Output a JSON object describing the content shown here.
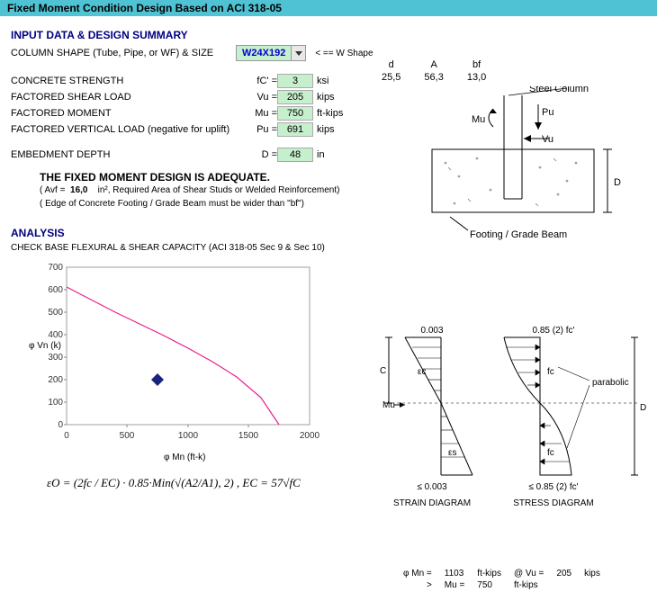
{
  "title_bar": "Fixed Moment Condition Design Based on ACI 318-05",
  "headers": {
    "input": "INPUT DATA & DESIGN SUMMARY",
    "analysis": "ANALYSIS"
  },
  "column_shape": {
    "label": "COLUMN SHAPE (Tube, Pipe, or WF) & SIZE",
    "value": "W24X192",
    "hint": "< ==    W Shape"
  },
  "shape_props": {
    "headers": [
      "d",
      "A",
      "bf"
    ],
    "values": [
      "25,5",
      "56,3",
      "13,0"
    ]
  },
  "inputs": {
    "fc": {
      "label": "CONCRETE STRENGTH",
      "sym": "fC' =",
      "value": "3",
      "unit": "ksi"
    },
    "vu": {
      "label": "FACTORED SHEAR LOAD",
      "sym": "Vu =",
      "value": "205",
      "unit": "kips"
    },
    "mu": {
      "label": "FACTORED MOMENT",
      "sym": "Mu =",
      "value": "750",
      "unit": "ft-kips"
    },
    "pu": {
      "label": "FACTORED VERTICAL LOAD (negative for uplift)",
      "sym": "Pu =",
      "value": "691",
      "unit": "kips"
    },
    "d": {
      "label": "EMBEDMENT DEPTH",
      "sym": "D =",
      "value": "48",
      "unit": "in"
    }
  },
  "adequate_msg": "THE FIXED MOMENT DESIGN IS ADEQUATE.",
  "avf": {
    "prefix": "( Avf  =",
    "value": "16,0",
    "unit": "in²",
    "note": ", Required Area of Shear Studs or Welded Reinforcement)"
  },
  "edge_note": "( Edge of Concrete Footing / Grade Beam must be wider than \"bf\")",
  "analysis_sub": "CHECK BASE FLEXURAL & SHEAR CAPACITY (ACI 318-05 Sec 9 & Sec 10)",
  "sketch": {
    "steel_col": "Steel Column",
    "mu": "Mu",
    "pu": "Pu",
    "vu": "Vu",
    "footing": "Footing  /  Grade Beam",
    "d": "D"
  },
  "chart_data": {
    "type": "line+scatter",
    "xlabel": "φ Mn (ft-k)",
    "ylabel": "φ Vn (k)",
    "xlim": [
      0,
      2000
    ],
    "ylim": [
      0,
      700
    ],
    "xticks": [
      0,
      500,
      1000,
      1500,
      2000
    ],
    "yticks": [
      0,
      100,
      200,
      300,
      400,
      500,
      600,
      700
    ],
    "series": [
      {
        "name": "capacity-curve",
        "color": "#e91e8c",
        "type": "line",
        "points": [
          [
            0,
            610
          ],
          [
            200,
            555
          ],
          [
            400,
            500
          ],
          [
            600,
            448
          ],
          [
            800,
            395
          ],
          [
            1000,
            340
          ],
          [
            1200,
            280
          ],
          [
            1400,
            210
          ],
          [
            1600,
            120
          ],
          [
            1750,
            0
          ]
        ]
      },
      {
        "name": "demand-point",
        "color": "#1a237e",
        "type": "scatter",
        "points": [
          [
            750,
            205
          ]
        ]
      }
    ]
  },
  "strain_stress": {
    "top1": "0.003",
    "top2": "0.85 (2) fc'",
    "ec": "εc",
    "fc": "fc",
    "mu": "Mu",
    "es": "εs",
    "bot1": "≤ 0.003",
    "bot2": "≤ 0.85 (2) fc'",
    "label1": "STRAIN  DIAGRAM",
    "label2": "STRESS  DIAGRAM",
    "parabolic": "parabolic",
    "c": "C",
    "d": "D"
  },
  "formula": "εO = (2fc / EC) · 0.85·Min(√(A2/A1), 2) ,   EC = 57√fC",
  "results": {
    "r1": {
      "a": "φ Mn =",
      "b": "1103",
      "c": "ft-kips",
      "d": "@ Vu =",
      "e": "205",
      "f": "kips"
    },
    "r2": {
      "a": ">",
      "b": "Mu =",
      "c": "750",
      "d": "ft-kips"
    }
  }
}
